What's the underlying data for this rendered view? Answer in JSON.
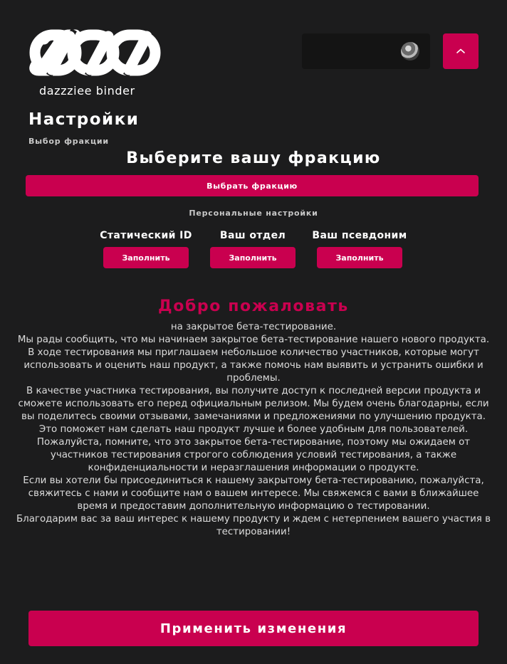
{
  "brand": {
    "name": "dazzziee binder"
  },
  "header": {
    "avatar_icon": "user-avatar",
    "toggle_icon": "chevron-up-icon"
  },
  "settings": {
    "title": "Настройки",
    "faction_section_label": "Выбор фракции",
    "faction_heading": "Выберите вашу фракцию",
    "choose_faction_label": "Выбрать фракцию",
    "personal_section_label": "Персональные настройки",
    "fields": [
      {
        "label": "Статический ID",
        "button": "Заполнить"
      },
      {
        "label": "Ваш отдел",
        "button": "Заполнить"
      },
      {
        "label": "Ваш псевдоним",
        "button": "Заполнить"
      }
    ]
  },
  "welcome": {
    "title": "Добро пожаловать",
    "paragraphs": [
      "на закрытое бета-тестирование.",
      "Мы рады сообщить, что мы начинаем закрытое бета-тестирование нашего нового продукта. В ходе тестирования мы приглашаем небольшое количество участников, которые могут использовать и оценить наш продукт, а также помочь нам выявить и устранить ошибки и проблемы.",
      "В качестве участника тестирования, вы получите доступ к последней версии продукта и сможете использовать его перед официальным релизом. Мы будем очень благодарны, если вы поделитесь своими отзывами, замечаниями и предложениями по улучшению продукта. Это поможет нам сделать наш продукт лучше и более удобным для пользователей.",
      "Пожалуйста, помните, что это закрытое бета-тестирование, поэтому мы ожидаем от участников тестирования строгого соблюдения условий тестирования, а также конфиденциальности и неразглашения информации о продукте.",
      "Если вы хотели бы присоединиться к нашему закрытому бета-тестированию, пожалуйста, свяжитесь с нами и сообщите нам о вашем интересе. Мы свяжемся с вами в ближайшее время и предоставим дополнительную информацию о тестировании.",
      "Благодарим вас за ваш интерес к нашему продукту и ждем с нетерпением вашего участия в тестировании!"
    ]
  },
  "apply_label": "Применить изменения",
  "colors": {
    "accent": "#c9004f",
    "background": "#1c1c1d",
    "panel": "#141414"
  }
}
